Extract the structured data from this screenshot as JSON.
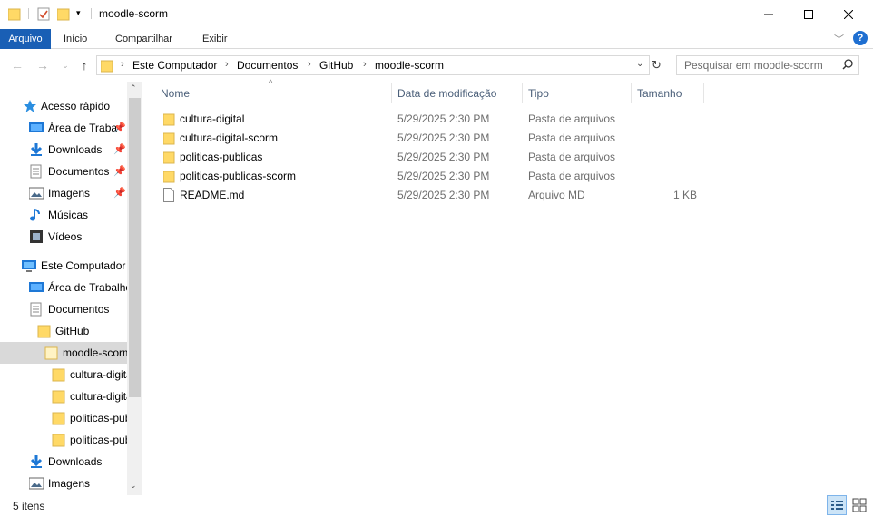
{
  "window": {
    "title": "moodle-scorm",
    "controls": {
      "minimize": "minimize-icon",
      "maximize": "maximize-icon",
      "close": "close-icon"
    }
  },
  "ribbon": {
    "tabs": [
      "Arquivo",
      "Início",
      "Compartilhar",
      "Exibir"
    ]
  },
  "address": {
    "crumbs": [
      "Este Computador",
      "Documentos",
      "GitHub",
      "moodle-scorm"
    ]
  },
  "search": {
    "placeholder": "Pesquisar em moodle-scorm"
  },
  "nav": {
    "items": [
      {
        "label": "Acesso rápido",
        "icon": "star-icon"
      },
      {
        "label": "Área de Traba",
        "icon": "desktop-icon",
        "pinned": true
      },
      {
        "label": "Downloads",
        "icon": "download-icon",
        "pinned": true
      },
      {
        "label": "Documentos",
        "icon": "document-icon",
        "pinned": true
      },
      {
        "label": "Imagens",
        "icon": "image-icon",
        "pinned": true
      },
      {
        "label": "Músicas",
        "icon": "music-icon"
      },
      {
        "label": "Vídeos",
        "icon": "video-icon"
      },
      {
        "label": "Este Computador",
        "icon": "computer-icon"
      },
      {
        "label": "Área de Trabalho",
        "icon": "desktop-icon"
      },
      {
        "label": "Documentos",
        "icon": "document-icon"
      },
      {
        "label": "GitHub",
        "icon": "folder-icon"
      },
      {
        "label": "moodle-scorm",
        "icon": "folder-icon",
        "selected": true
      },
      {
        "label": "cultura-digital",
        "icon": "folder-icon"
      },
      {
        "label": "cultura-digital-scorm",
        "icon": "folder-icon"
      },
      {
        "label": "politicas-publicas",
        "icon": "folder-icon"
      },
      {
        "label": "politicas-publicas-scorm",
        "icon": "folder-icon"
      },
      {
        "label": "Downloads",
        "icon": "download-icon"
      },
      {
        "label": "Imagens",
        "icon": "image-icon"
      }
    ]
  },
  "columns": {
    "name": "Nome",
    "date": "Data de modificação",
    "type": "Tipo",
    "size": "Tamanho"
  },
  "files": [
    {
      "name": "cultura-digital",
      "date": "5/29/2025 2:30 PM",
      "type": "Pasta de arquivos",
      "size": "",
      "icon": "folder-icon"
    },
    {
      "name": "cultura-digital-scorm",
      "date": "5/29/2025 2:30 PM",
      "type": "Pasta de arquivos",
      "size": "",
      "icon": "folder-icon"
    },
    {
      "name": "politicas-publicas",
      "date": "5/29/2025 2:30 PM",
      "type": "Pasta de arquivos",
      "size": "",
      "icon": "folder-icon"
    },
    {
      "name": "politicas-publicas-scorm",
      "date": "5/29/2025 2:30 PM",
      "type": "Pasta de arquivos",
      "size": "",
      "icon": "folder-icon"
    },
    {
      "name": "README.md",
      "date": "5/29/2025 2:30 PM",
      "type": "Arquivo MD",
      "size": "1 KB",
      "icon": "file-icon"
    }
  ],
  "status": {
    "count": "5 itens"
  },
  "colors": {
    "accent": "#195fb5",
    "selection": "#d9d9d9",
    "header_text": "#4c607a"
  }
}
